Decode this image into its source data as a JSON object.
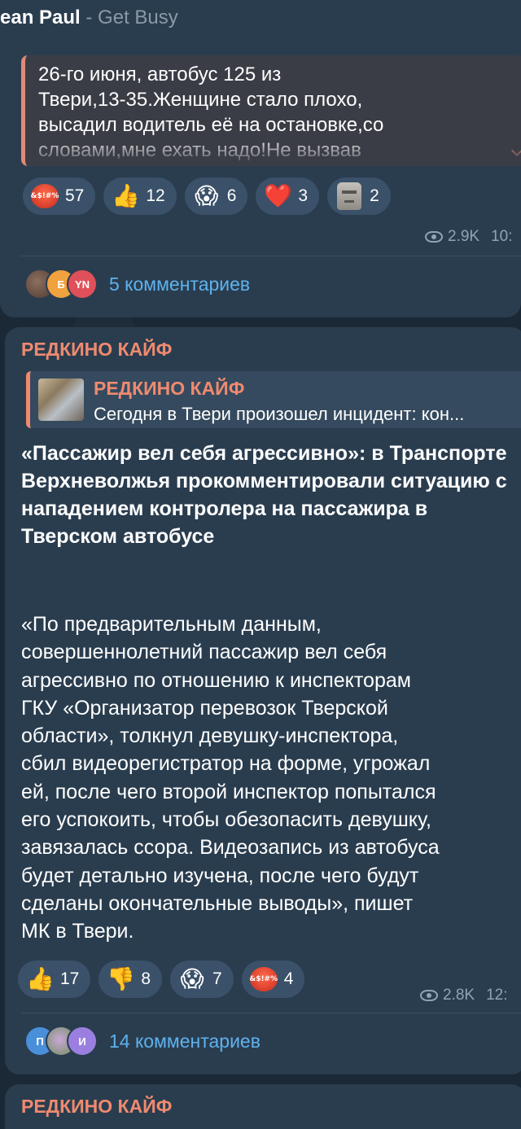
{
  "music": {
    "artist": "ean Paul",
    "separator": " - ",
    "song": "Get Busy"
  },
  "post1": {
    "quote_lines": [
      "26-го июня, автобус 125 из",
      "Твери,13-35.Женщине стало плохо,",
      "высадил водитель её на остановке,со",
      "словами,мне ехать надо!Не вызвав"
    ],
    "reactions": [
      {
        "icon": "angry-face-icon",
        "count": "57"
      },
      {
        "icon": "thumbs-up-icon",
        "emoji": "👍",
        "count": "12"
      },
      {
        "icon": "screaming-face-icon",
        "emoji": "😱",
        "count": "6"
      },
      {
        "icon": "red-heart-icon",
        "emoji": "❤️",
        "count": "3"
      },
      {
        "icon": "moai-icon",
        "count": "2"
      }
    ],
    "views": "2.9K",
    "time": "10:",
    "avatars": [
      "",
      "Б",
      "YN"
    ],
    "comments": "5 комментариев"
  },
  "post2": {
    "channel": "РЕДКИНО КАЙФ",
    "forward_title": "РЕДКИНО КАЙФ",
    "forward_text": "Сегодня в Твери произошел инцидент: кон...",
    "headline": "«Пассажир вел себя агрессивно»: в Транспорте Верхневолжья прокомментировали ситуацию с нападением контролера на пассажира в Тверском автобусе",
    "body_lines": [
      "«По предварительным данным,",
      "совершеннолетний пассажир вел себя",
      "агрессивно по отношению к инспекторам",
      "ГКУ «Организатор перевозок Тверской",
      "области», толкнул девушку-инспектора,",
      "сбил видеорегистратор на форме, угрожал",
      "ей, после чего второй инспектор попытался",
      "его успокоить, чтобы обезопасить девушку,",
      "завязалась ссора. Видеозапись из автобуса",
      "будет детально изучена, после чего будут",
      "сделаны окончательные выводы», пишет",
      "МК в Твери."
    ],
    "reactions": [
      {
        "icon": "thumbs-up-icon",
        "emoji": "👍",
        "count": "17"
      },
      {
        "icon": "thumbs-down-icon",
        "emoji": "👎",
        "count": "8"
      },
      {
        "icon": "screaming-face-icon",
        "emoji": "😱",
        "count": "7"
      },
      {
        "icon": "angry-face-icon",
        "count": "4"
      }
    ],
    "views": "2.8K",
    "time": "12:",
    "avatars": [
      "П",
      "",
      "И"
    ],
    "comments": "14 комментариев"
  },
  "post3": {
    "channel": "РЕДКИНО КАЙФ"
  },
  "colors": {
    "accent": "#ef8a6f",
    "link": "#5eb2ee",
    "bubble": "#2a3d4f",
    "reaction": "#3a5169"
  }
}
